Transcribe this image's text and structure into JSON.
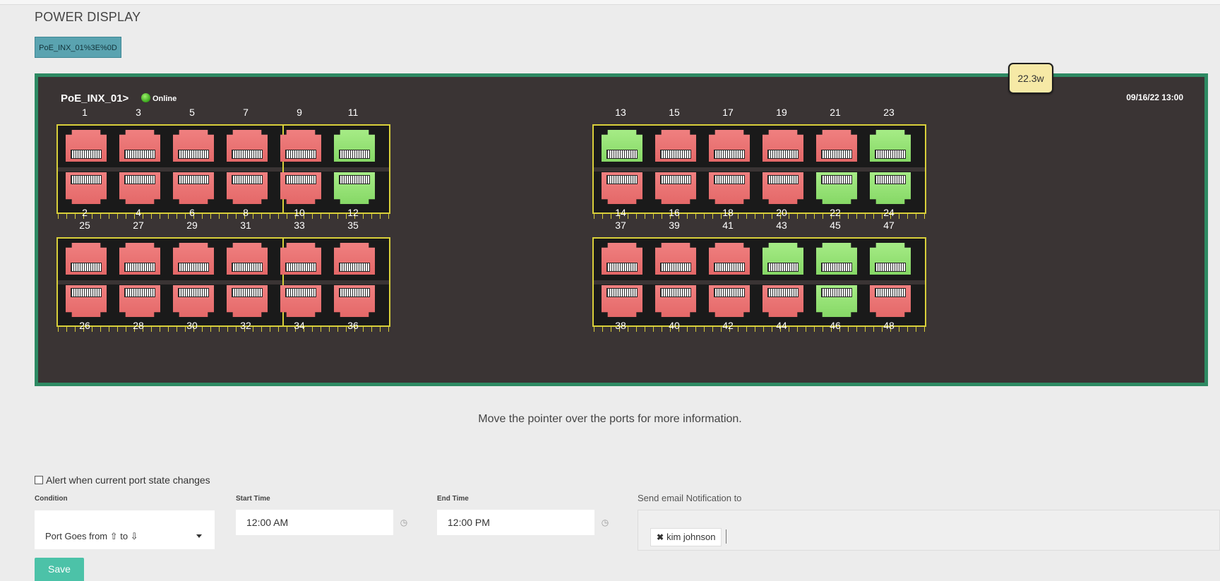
{
  "page": {
    "title": "POWER DISPLAY"
  },
  "device_tab": {
    "label": "PoE_INX_01%3E%0D"
  },
  "device": {
    "name": "PoE_INX_01>",
    "status": "Online",
    "timestamp": "09/16/22 13:00",
    "power": "22.3w"
  },
  "ports": [
    {
      "n": 1,
      "s": "down"
    },
    {
      "n": 2,
      "s": "down"
    },
    {
      "n": 3,
      "s": "down"
    },
    {
      "n": 4,
      "s": "down"
    },
    {
      "n": 5,
      "s": "down"
    },
    {
      "n": 6,
      "s": "down"
    },
    {
      "n": 7,
      "s": "down"
    },
    {
      "n": 8,
      "s": "down"
    },
    {
      "n": 9,
      "s": "down"
    },
    {
      "n": 10,
      "s": "down"
    },
    {
      "n": 11,
      "s": "up"
    },
    {
      "n": 12,
      "s": "up"
    },
    {
      "n": 13,
      "s": "up"
    },
    {
      "n": 14,
      "s": "down"
    },
    {
      "n": 15,
      "s": "down"
    },
    {
      "n": 16,
      "s": "down"
    },
    {
      "n": 17,
      "s": "down"
    },
    {
      "n": 18,
      "s": "down"
    },
    {
      "n": 19,
      "s": "down"
    },
    {
      "n": 20,
      "s": "down"
    },
    {
      "n": 21,
      "s": "down"
    },
    {
      "n": 22,
      "s": "up"
    },
    {
      "n": 23,
      "s": "up"
    },
    {
      "n": 24,
      "s": "up"
    },
    {
      "n": 25,
      "s": "down"
    },
    {
      "n": 26,
      "s": "down"
    },
    {
      "n": 27,
      "s": "down"
    },
    {
      "n": 28,
      "s": "down"
    },
    {
      "n": 29,
      "s": "down"
    },
    {
      "n": 30,
      "s": "down"
    },
    {
      "n": 31,
      "s": "down"
    },
    {
      "n": 32,
      "s": "down"
    },
    {
      "n": 33,
      "s": "down"
    },
    {
      "n": 34,
      "s": "down"
    },
    {
      "n": 35,
      "s": "down"
    },
    {
      "n": 36,
      "s": "down"
    },
    {
      "n": 37,
      "s": "down"
    },
    {
      "n": 38,
      "s": "down"
    },
    {
      "n": 39,
      "s": "down"
    },
    {
      "n": 40,
      "s": "down"
    },
    {
      "n": 41,
      "s": "down"
    },
    {
      "n": 42,
      "s": "down"
    },
    {
      "n": 43,
      "s": "up"
    },
    {
      "n": 44,
      "s": "down"
    },
    {
      "n": 45,
      "s": "up"
    },
    {
      "n": 46,
      "s": "up"
    },
    {
      "n": 47,
      "s": "up"
    },
    {
      "n": 48,
      "s": "down"
    }
  ],
  "hint": "Move the pointer over the ports for more information.",
  "alert": {
    "label": "Alert when current port state changes",
    "checked": false,
    "condition_label": "Condition",
    "condition_value": "Port Goes from ⇧ to ⇩",
    "start_label": "Start Time",
    "start_value": "12:00 AM",
    "end_label": "End Time",
    "end_value": "12:00 PM",
    "email_label": "Send email Notification to",
    "recipients": [
      "kim johnson"
    ],
    "save_label": "Save"
  },
  "colors": {
    "port_down": "#e46868",
    "port_up": "#86d866",
    "frame": "#2e8a63",
    "accent": "#4cc2a8"
  }
}
